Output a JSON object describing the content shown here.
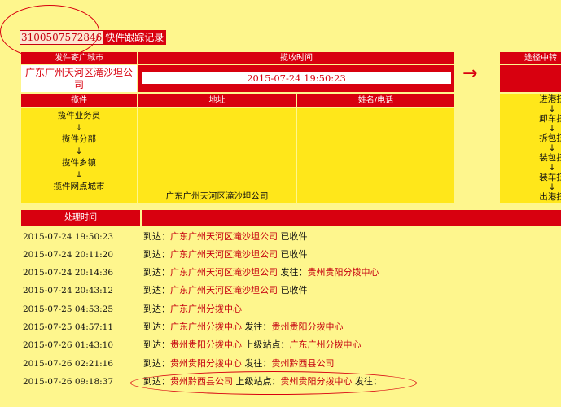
{
  "title": {
    "tracking_number": "3100507572846",
    "label": "快件跟踪记录"
  },
  "shipment": {
    "origin_city_header": "发件寄广城市",
    "origin_city_value": "广东广州天河区滝沙坦公司",
    "pickup_time_header": "揽收时间",
    "pickup_time_value": "2015-07-24 19:50:23",
    "pickup_header": "揽件",
    "address_header": "地址",
    "name_phone_header": "姓名/电话",
    "pickup_steps": [
      "揽件业务员",
      "↓",
      "揽件分部",
      "↓",
      "揽件乡镇",
      "↓",
      "揽件网点城市"
    ],
    "address_value": "广东广州天河区滝沙坦公司",
    "arrow": "→"
  },
  "transit": {
    "header": "途径中转",
    "steps": [
      "进港扫",
      "↓",
      "卸车扫",
      "↓",
      "拆包扫",
      "↓",
      "装包扫",
      "↓",
      "装车扫",
      "↓",
      "出港扫"
    ]
  },
  "records": {
    "time_header": "处理时间",
    "rows": [
      {
        "time": "2015-07-24 19:50:23",
        "parts": [
          {
            "t": "到达："
          },
          {
            "t": "广东广州天河区滝沙坦公司",
            "link": true
          },
          {
            "t": " 已收件"
          }
        ]
      },
      {
        "time": "2015-07-24 20:11:20",
        "parts": [
          {
            "t": "到达："
          },
          {
            "t": "广东广州天河区滝沙坦公司",
            "link": true
          },
          {
            "t": " 已收件"
          }
        ]
      },
      {
        "time": "2015-07-24 20:14:36",
        "parts": [
          {
            "t": "到达："
          },
          {
            "t": "广东广州天河区滝沙坦公司",
            "link": true
          },
          {
            "t": " 发往："
          },
          {
            "t": "贵州贵阳分拨中心",
            "link": true
          }
        ]
      },
      {
        "time": "2015-07-24 20:43:12",
        "parts": [
          {
            "t": "到达："
          },
          {
            "t": "广东广州天河区滝沙坦公司",
            "link": true
          },
          {
            "t": " 已收件"
          }
        ]
      },
      {
        "time": "2015-07-25 04:53:25",
        "parts": [
          {
            "t": "到达："
          },
          {
            "t": "广东广州分拨中心",
            "link": true
          }
        ]
      },
      {
        "time": "2015-07-25 04:57:11",
        "parts": [
          {
            "t": "到达："
          },
          {
            "t": "广东广州分拨中心",
            "link": true
          },
          {
            "t": " 发往："
          },
          {
            "t": "贵州贵阳分拨中心",
            "link": true
          }
        ]
      },
      {
        "time": "2015-07-26 01:43:10",
        "parts": [
          {
            "t": "到达："
          },
          {
            "t": "贵州贵阳分拨中心",
            "link": true
          },
          {
            "t": " 上级站点："
          },
          {
            "t": "广东广州分拨中心",
            "link": true
          }
        ]
      },
      {
        "time": "2015-07-26 02:21:16",
        "parts": [
          {
            "t": "到达："
          },
          {
            "t": "贵州贵阳分拨中心",
            "link": true
          },
          {
            "t": " 发往："
          },
          {
            "t": "贵州黔西县公司",
            "link": true
          }
        ]
      },
      {
        "time": "2015-07-26 09:18:37",
        "parts": [
          {
            "t": "到达："
          },
          {
            "t": "贵州黔西县公司",
            "link": true
          },
          {
            "t": " 上级站点："
          },
          {
            "t": "贵州贵阳分拨中心",
            "link": true
          },
          {
            "t": " 发往："
          }
        ]
      }
    ]
  },
  "colors": {
    "accent": "#d8000f",
    "cell": "#ffe71a",
    "background": "#fef68d"
  }
}
